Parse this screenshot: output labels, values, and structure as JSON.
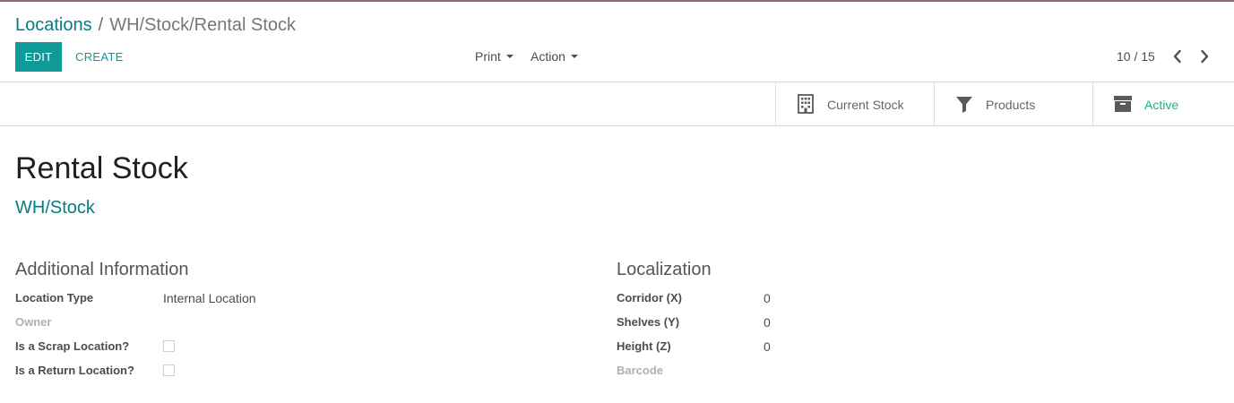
{
  "breadcrumb": {
    "parent": "Locations",
    "separator": "/",
    "current": "WH/Stock/Rental Stock"
  },
  "toolbar": {
    "edit_label": "EDIT",
    "create_label": "CREATE",
    "print_label": "Print",
    "action_label": "Action"
  },
  "pager": {
    "value": "10 / 15"
  },
  "button_box": {
    "current_stock": "Current Stock",
    "products": "Products",
    "active": "Active"
  },
  "record": {
    "name": "Rental Stock",
    "parent": "WH/Stock"
  },
  "additional_information": {
    "title": "Additional Information",
    "location_type_label": "Location Type",
    "location_type_value": "Internal Location",
    "owner_label": "Owner",
    "scrap_label": "Is a Scrap Location?",
    "return_label": "Is a Return Location?"
  },
  "localization": {
    "title": "Localization",
    "corridor_label": "Corridor (X)",
    "corridor_value": "0",
    "shelves_label": "Shelves (Y)",
    "shelves_value": "0",
    "height_label": "Height (Z)",
    "height_value": "0",
    "barcode_label": "Barcode"
  },
  "colors": {
    "accent": "#017e84",
    "primary_button": "#0f9a9a",
    "active_status": "#21b27c"
  },
  "icons": {
    "current_stock": "building-icon",
    "products": "filter-icon",
    "active": "archive-icon",
    "pager_prev": "chevron-left-icon",
    "pager_next": "chevron-right-icon"
  }
}
